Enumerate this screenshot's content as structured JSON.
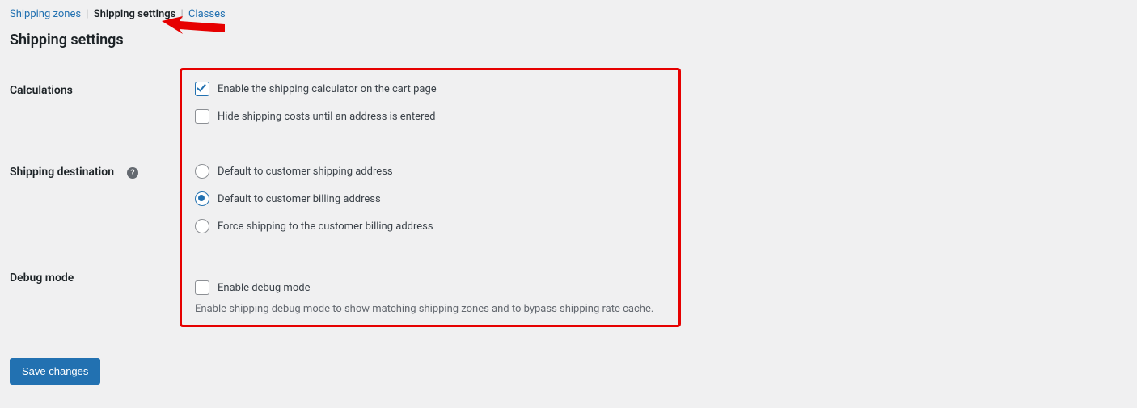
{
  "subnav": {
    "items": [
      {
        "label": "Shipping zones",
        "active": false
      },
      {
        "label": "Shipping settings",
        "active": true
      },
      {
        "label": "Classes",
        "active": false
      }
    ]
  },
  "page_title": "Shipping settings",
  "sections": {
    "calculations": {
      "heading": "Calculations",
      "opt_enable_calc": "Enable the shipping calculator on the cart page",
      "opt_hide_costs": "Hide shipping costs until an address is entered"
    },
    "destination": {
      "heading": "Shipping destination",
      "opt_shipping": "Default to customer shipping address",
      "opt_billing": "Default to customer billing address",
      "opt_force_billing": "Force shipping to the customer billing address"
    },
    "debug": {
      "heading": "Debug mode",
      "opt_enable": "Enable debug mode",
      "hint": "Enable shipping debug mode to show matching shipping zones and to bypass shipping rate cache."
    }
  },
  "help_icon_glyph": "?",
  "save_button": "Save changes",
  "state": {
    "calc_enable_checked": true,
    "calc_hide_checked": false,
    "destination_selected": "billing",
    "debug_enable_checked": false
  },
  "colors": {
    "link": "#2271b1",
    "highlight": "#e60000",
    "primary": "#2271b1"
  }
}
